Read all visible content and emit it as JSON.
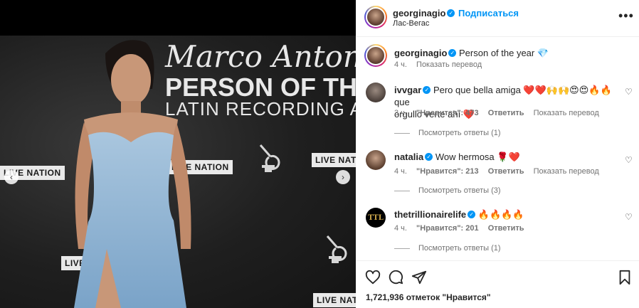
{
  "post": {
    "username": "georginagio",
    "follow_label": "Подписаться",
    "location": "Лас-Вегас",
    "caption": "Person of the year 💎",
    "caption_time": "4 ч.",
    "caption_translate": "Показать перевод",
    "likes": "1,721,936 отметок \"Нравится\""
  },
  "backdrop": {
    "script": "Marco Antonio S",
    "line1": "PERSON OF THE YE",
    "line2": "LATIN RECORDING ACA",
    "livenation": "LIVE NATION"
  },
  "comments": [
    {
      "username": "ivvgar",
      "text_line1": "Pero que bella amiga ❤️❤️🙌🙌😍😍🔥🔥 que",
      "text_line2": "orgullo verte ahí ❤️",
      "time": "3 ч.",
      "likes": "\"Нравится\": 473",
      "reply": "Ответить",
      "translate": "Показать перевод",
      "view_replies": "Посмотреть ответы (1)"
    },
    {
      "username": "natalia",
      "text_line1": "Wow hermosa 🌹❤️",
      "time": "4 ч.",
      "likes": "\"Нравится\": 213",
      "reply": "Ответить",
      "translate": "Показать перевод",
      "view_replies": "Посмотреть ответы (3)"
    },
    {
      "username": "thetrillionairelife",
      "text_line1": "🔥🔥🔥🔥",
      "time": "4 ч.",
      "likes": "\"Нравится\": 201",
      "reply": "Ответить",
      "view_replies": "Посмотреть ответы (1)"
    }
  ],
  "colors": {
    "accent": "#0095f6",
    "heart": "#ed4956",
    "muted": "#737373"
  },
  "icons": [
    "heart-icon",
    "comment-icon",
    "share-icon",
    "bookmark-icon",
    "more-icon",
    "verified-icon",
    "chevron-right-icon",
    "chevron-left-icon"
  ]
}
